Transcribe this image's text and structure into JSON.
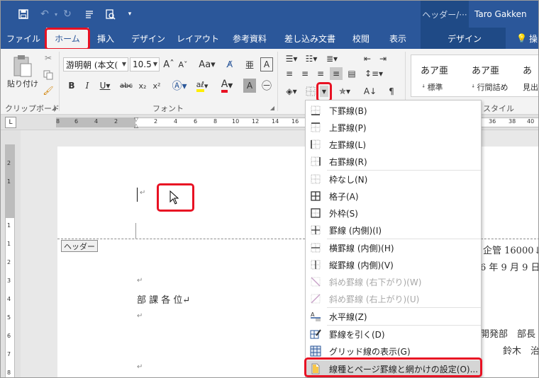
{
  "title_bar": {
    "context_header": "ヘッダー/···",
    "user": "Taro Gakken",
    "qa_icons": [
      "save-icon",
      "undo-icon",
      "redo-icon",
      "touch-mode-icon",
      "print-preview-icon",
      "customize-icon"
    ]
  },
  "tabs": [
    "ファイル",
    "ホーム",
    "挿入",
    "デザイン",
    "レイアウト",
    "参考資料",
    "差し込み文書",
    "校閲",
    "表示",
    "デザイン",
    "操"
  ],
  "ribbon": {
    "clipboard_label": "クリップボード",
    "paste_label": "貼り付け",
    "font_label": "フォント",
    "font_name": "游明朝 (本文(",
    "font_size": "10.5",
    "style_label": "スタイル",
    "styles": [
      {
        "sample": "あア亜",
        "name": "標準"
      },
      {
        "sample": "あア亜",
        "name": "行間詰め"
      },
      {
        "sample": "あ",
        "name": "見出"
      }
    ]
  },
  "ruler": {
    "numbers": [
      "8",
      "6",
      "4",
      "2",
      "2",
      "4",
      "6",
      "8",
      "10",
      "12",
      "14",
      "16",
      "36",
      "38",
      "40"
    ],
    "vnumbers": [
      "2",
      "1",
      "1",
      "1",
      "2",
      "3",
      "4",
      "5",
      "6",
      "7",
      "8"
    ]
  },
  "document": {
    "header_tag": "ヘッダー",
    "right_line1": "企管 16000↓",
    "right_line2": "6 年 9 月 9 日↓",
    "right_line3": "開発部　部長",
    "right_line4": "鈴木　治",
    "addressee": "部 課 各 位↵",
    "para_mark": "↵"
  },
  "menu": {
    "items": [
      {
        "label": "下罫線(B)",
        "icon": "bottom-border-icon",
        "disabled": false
      },
      {
        "label": "上罫線(P)",
        "icon": "top-border-icon",
        "disabled": false
      },
      {
        "label": "左罫線(L)",
        "icon": "left-border-icon",
        "disabled": false
      },
      {
        "label": "右罫線(R)",
        "icon": "right-border-icon",
        "disabled": false
      },
      {
        "label": "枠なし(N)",
        "icon": "no-border-icon",
        "disabled": false
      },
      {
        "label": "格子(A)",
        "icon": "all-borders-icon",
        "disabled": false
      },
      {
        "label": "外枠(S)",
        "icon": "outside-borders-icon",
        "disabled": false
      },
      {
        "label": "罫線 (内側)(I)",
        "icon": "inside-borders-icon",
        "disabled": false
      },
      {
        "label": "横罫線 (内側)(H)",
        "icon": "inside-horizontal-border-icon",
        "disabled": false
      },
      {
        "label": "縦罫線 (内側)(V)",
        "icon": "inside-vertical-border-icon",
        "disabled": false
      },
      {
        "label": "斜め罫線 (右下がり)(W)",
        "icon": "diagonal-down-border-icon",
        "disabled": true
      },
      {
        "label": "斜め罫線 (右上がり)(U)",
        "icon": "diagonal-up-border-icon",
        "disabled": true
      },
      {
        "label": "水平線(Z)",
        "icon": "horizontal-line-icon",
        "disabled": false
      },
      {
        "label": "罫線を引く(D)",
        "icon": "draw-table-icon",
        "disabled": false
      },
      {
        "label": "グリッド線の表示(G)",
        "icon": "view-gridlines-icon",
        "disabled": false
      },
      {
        "label": "線種とページ罫線と網かけの設定(O)...",
        "icon": "borders-shading-icon",
        "disabled": false
      }
    ]
  },
  "colors": {
    "accent": "#2b579a",
    "highlight": "#e81123"
  }
}
